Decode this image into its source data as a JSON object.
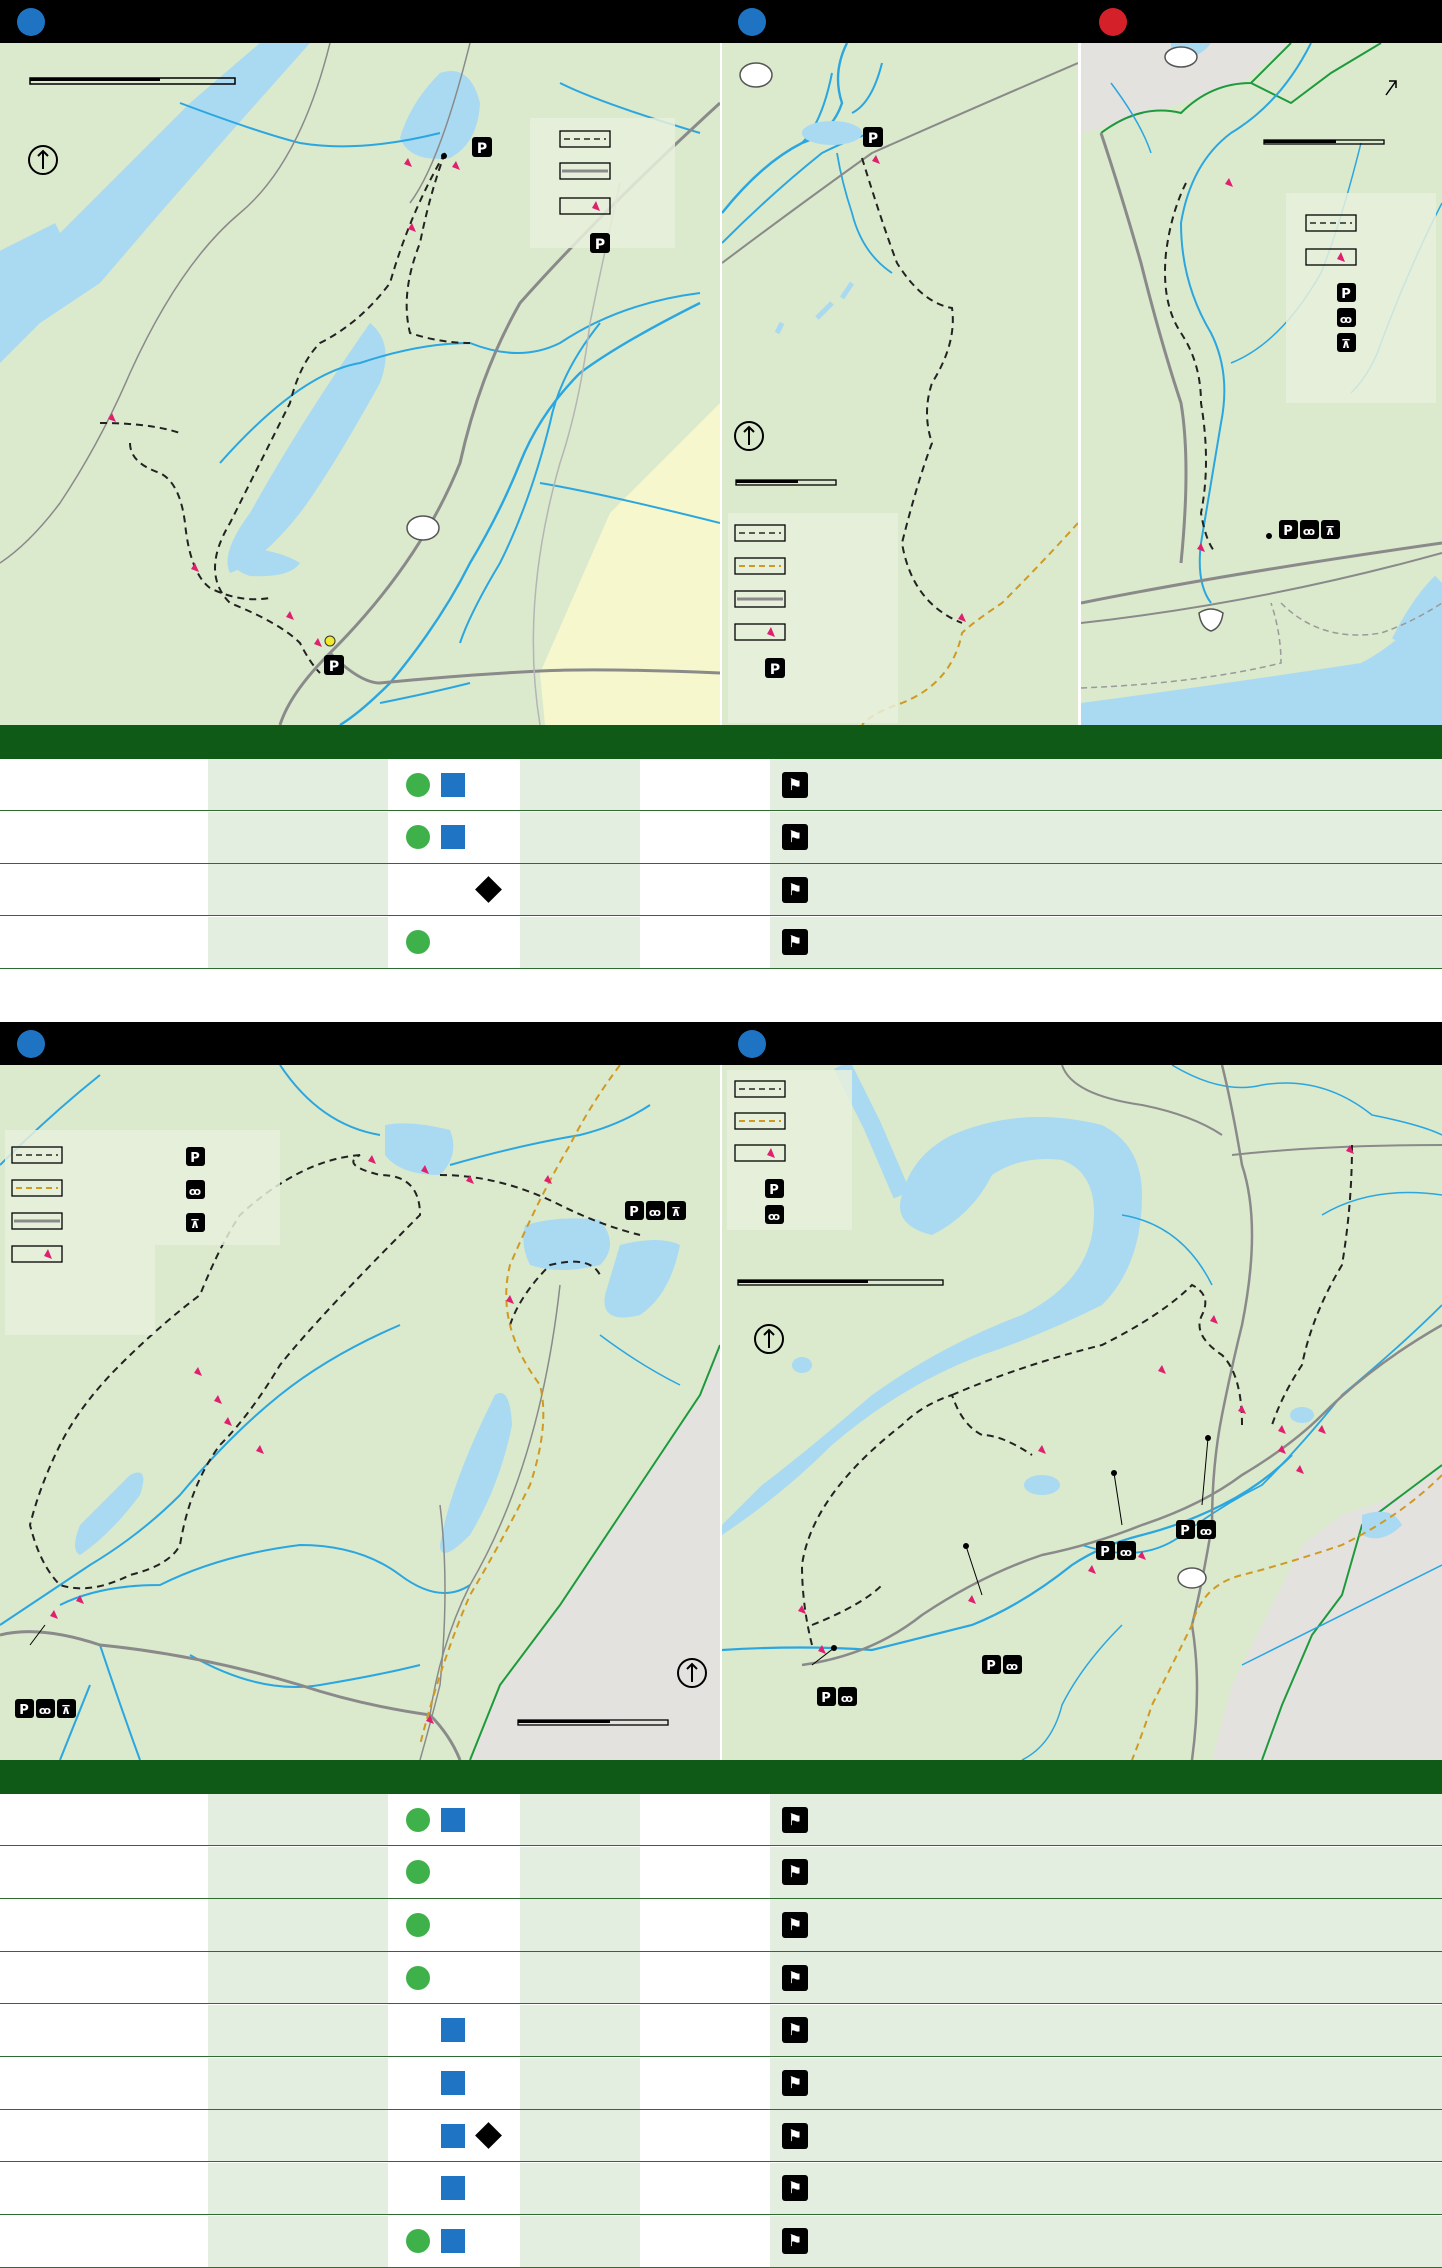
{
  "colors": {
    "black_bar": "#000000",
    "map_land": "#dbe9cd",
    "water": "#a9daf2",
    "stream": "#2aa6e0",
    "table_header": "#0e5a16",
    "row_shade": "#e3eee0",
    "marker_blue": "#1e74c3",
    "marker_red": "#d42028",
    "easy_green": "#3fb14a",
    "moderate_blue": "#1f74c4",
    "difficult_black": "#000000",
    "trail_marker": "#e0206f"
  },
  "icons": {
    "parking": "P",
    "restrooms": "restroom-icon",
    "picnic": "picnic-table-icon",
    "pets": "dog-icon",
    "north": "north-arrow-icon"
  },
  "top_table": {
    "rows": [
      {
        "difficulty": [
          "easy",
          "moderate"
        ]
      },
      {
        "difficulty": [
          "easy",
          "moderate"
        ]
      },
      {
        "difficulty": [
          "difficult"
        ]
      },
      {
        "difficulty": [
          "easy"
        ]
      }
    ]
  },
  "bottom_table": {
    "rows": [
      {
        "difficulty": [
          "easy",
          "moderate"
        ]
      },
      {
        "difficulty": [
          "easy"
        ]
      },
      {
        "difficulty": [
          "easy"
        ]
      },
      {
        "difficulty": [
          "easy"
        ]
      },
      {
        "difficulty": [
          "moderate"
        ]
      },
      {
        "difficulty": [
          "moderate"
        ]
      },
      {
        "difficulty": [
          "moderate",
          "difficult"
        ]
      },
      {
        "difficulty": [
          "moderate"
        ]
      },
      {
        "difficulty": [
          "easy",
          "moderate"
        ]
      }
    ]
  }
}
